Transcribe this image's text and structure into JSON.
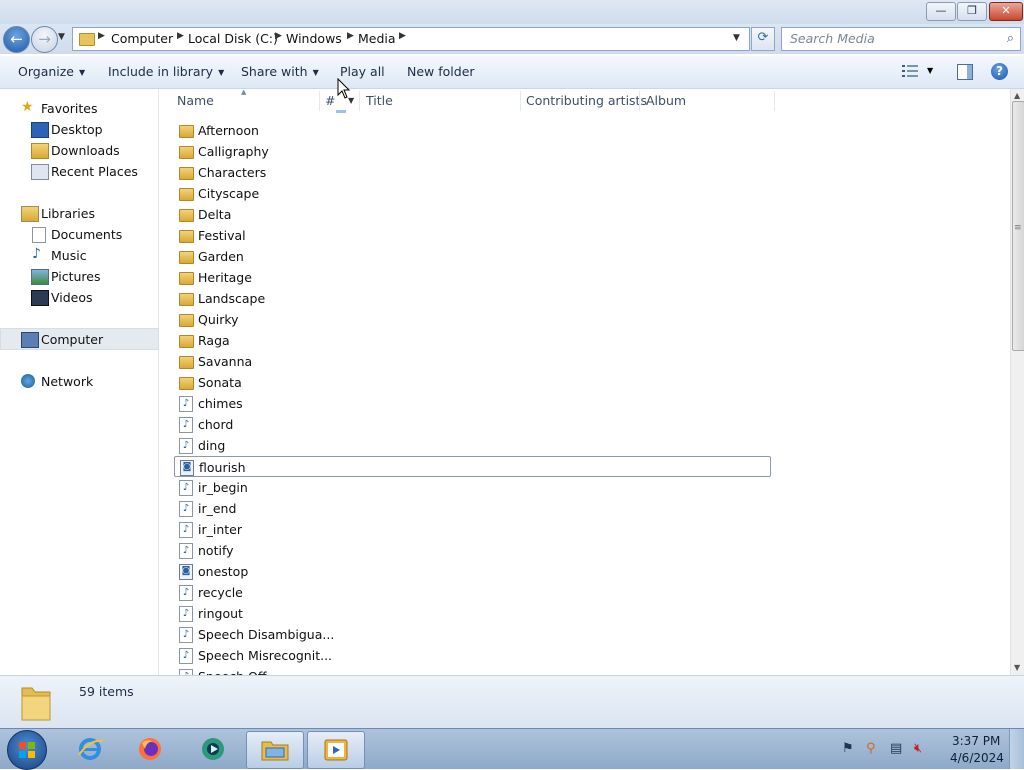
{
  "window": {
    "minimize": "—",
    "maximize": "❐",
    "close": "✕"
  },
  "address": {
    "crumbs": [
      "Computer",
      "Local Disk (C:)",
      "Windows",
      "Media"
    ],
    "separator": "▶",
    "dropdown": "▼"
  },
  "search": {
    "placeholder": "Search Media",
    "icon": "search-icon"
  },
  "toolbar": {
    "organize": "Organize",
    "include_in_library": "Include in library",
    "share_with": "Share with",
    "play_all": "Play all",
    "new_folder": "New folder",
    "help": "?"
  },
  "nav": {
    "favorites": "Favorites",
    "desktop": "Desktop",
    "downloads": "Downloads",
    "recent_places": "Recent Places",
    "libraries": "Libraries",
    "documents": "Documents",
    "music": "Music",
    "pictures": "Pictures",
    "videos": "Videos",
    "computer": "Computer",
    "network": "Network"
  },
  "columns": {
    "name": "Name",
    "number": "#",
    "title": "Title",
    "contributing_artists": "Contributing artists",
    "album": "Album"
  },
  "files": [
    {
      "name": "Afternoon",
      "type": "folder"
    },
    {
      "name": "Calligraphy",
      "type": "folder"
    },
    {
      "name": "Characters",
      "type": "folder"
    },
    {
      "name": "Cityscape",
      "type": "folder"
    },
    {
      "name": "Delta",
      "type": "folder"
    },
    {
      "name": "Festival",
      "type": "folder"
    },
    {
      "name": "Garden",
      "type": "folder"
    },
    {
      "name": "Heritage",
      "type": "folder"
    },
    {
      "name": "Landscape",
      "type": "folder"
    },
    {
      "name": "Quirky",
      "type": "folder"
    },
    {
      "name": "Raga",
      "type": "folder"
    },
    {
      "name": "Savanna",
      "type": "folder"
    },
    {
      "name": "Sonata",
      "type": "folder"
    },
    {
      "name": "chimes",
      "type": "audio"
    },
    {
      "name": "chord",
      "type": "audio"
    },
    {
      "name": "ding",
      "type": "audio"
    },
    {
      "name": "flourish",
      "type": "midi",
      "selected": true
    },
    {
      "name": "ir_begin",
      "type": "audio"
    },
    {
      "name": "ir_end",
      "type": "audio"
    },
    {
      "name": "ir_inter",
      "type": "audio"
    },
    {
      "name": "notify",
      "type": "audio"
    },
    {
      "name": "onestop",
      "type": "midi"
    },
    {
      "name": "recycle",
      "type": "audio"
    },
    {
      "name": "ringout",
      "type": "audio"
    },
    {
      "name": "Speech Disambigua...",
      "type": "audio"
    },
    {
      "name": "Speech Misrecognit...",
      "type": "audio"
    },
    {
      "name": "Speech Off",
      "type": "audio"
    }
  ],
  "status": {
    "item_count": "59 items"
  },
  "taskbar": {
    "apps": [
      "internet-explorer-icon",
      "firefox-icon",
      "media-app-icon",
      "windows-explorer-icon",
      "media-player-icon"
    ],
    "time": "3:37 PM",
    "date": "4/6/2024"
  },
  "colors": {
    "accent": "#1d5aa8",
    "chrome": "#dbe6f3",
    "taskbar": "#9fb6d3"
  }
}
